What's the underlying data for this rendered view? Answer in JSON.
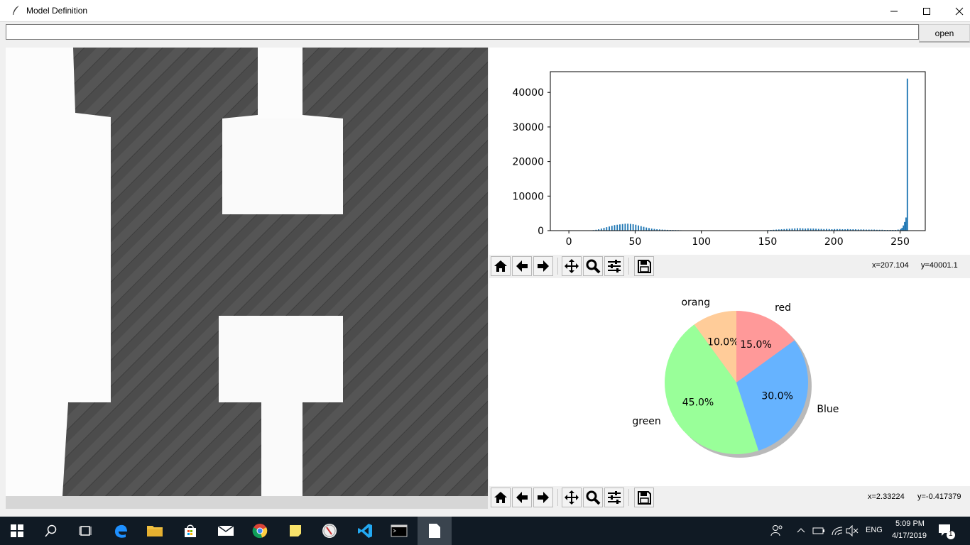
{
  "window": {
    "title": "Model Definition"
  },
  "pathbar": {
    "value": "",
    "open_label": "open"
  },
  "histogram_coords": {
    "x": "x=207.104",
    "y": "y=40001.1"
  },
  "pie_coords": {
    "x": "x=2.33224",
    "y": "y=-0.417379"
  },
  "chart_data": [
    {
      "type": "bar",
      "title": "",
      "xlabel": "",
      "ylabel": "",
      "xlim": [
        -14,
        269
      ],
      "ylim": [
        0,
        46000
      ],
      "xticks": [
        0,
        50,
        100,
        150,
        200,
        250
      ],
      "yticks": [
        0,
        10000,
        20000,
        30000,
        40000
      ],
      "color": "#1f77b4",
      "x": [
        18,
        20,
        22,
        24,
        26,
        28,
        30,
        32,
        34,
        36,
        38,
        40,
        42,
        44,
        46,
        48,
        50,
        52,
        54,
        56,
        58,
        60,
        62,
        64,
        66,
        68,
        70,
        72,
        74,
        76,
        78,
        80,
        82,
        84,
        150,
        152,
        154,
        156,
        158,
        160,
        162,
        164,
        166,
        168,
        170,
        172,
        174,
        176,
        178,
        180,
        182,
        184,
        186,
        188,
        190,
        192,
        194,
        196,
        198,
        200,
        202,
        204,
        206,
        208,
        210,
        212,
        214,
        216,
        218,
        220,
        222,
        224,
        226,
        228,
        230,
        232,
        234,
        236,
        238,
        240,
        242,
        244,
        246,
        248,
        250,
        251,
        252,
        253,
        254,
        255
      ],
      "values": [
        150,
        250,
        400,
        600,
        800,
        1000,
        1200,
        1400,
        1600,
        1700,
        1800,
        1900,
        2000,
        2000,
        1950,
        1850,
        1700,
        1500,
        1300,
        1100,
        900,
        750,
        600,
        500,
        400,
        350,
        300,
        260,
        220,
        200,
        180,
        160,
        140,
        120,
        150,
        200,
        250,
        300,
        350,
        400,
        450,
        500,
        550,
        600,
        650,
        700,
        700,
        650,
        600,
        650,
        600,
        600,
        550,
        500,
        500,
        450,
        500,
        450,
        400,
        450,
        450,
        450,
        400,
        400,
        450,
        400,
        400,
        400,
        350,
        350,
        350,
        300,
        300,
        300,
        300,
        250,
        250,
        250,
        200,
        200,
        200,
        200,
        200,
        300,
        500,
        800,
        1500,
        2500,
        3800,
        44000
      ]
    },
    {
      "type": "pie",
      "labels": [
        "orang",
        "green",
        "Blue",
        "red"
      ],
      "values": [
        10.0,
        45.0,
        30.0,
        15.0
      ],
      "autopct": [
        "10.0%",
        "45.0%",
        "30.0%",
        "15.0%"
      ],
      "colors": [
        "#ffcc99",
        "#99ff99",
        "#66b3ff",
        "#ff9999"
      ],
      "shadow": true,
      "startangle": 90
    }
  ],
  "taskbar": {
    "apps": [
      "start",
      "search",
      "task-view",
      "edge",
      "file-explorer",
      "store",
      "mail",
      "chrome",
      "sticky-notes",
      "app",
      "vscode",
      "cmd",
      "document"
    ],
    "lang": "ENG",
    "time": "5:09 PM",
    "date": "4/17/2019",
    "notifications": "1"
  }
}
